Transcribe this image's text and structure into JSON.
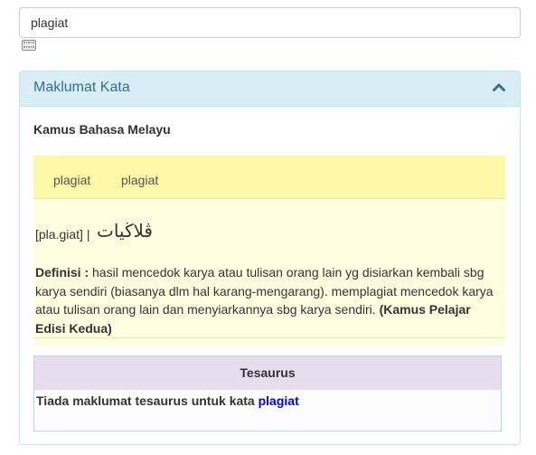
{
  "search": {
    "value": "plagiat"
  },
  "keyboard_icon": "keyboard-icon",
  "panel": {
    "title": "Maklumat Kata",
    "toggle_icon": "chevron-up-icon"
  },
  "colors": {
    "heading_bg": "#d9edf7",
    "heading_text": "#31708f",
    "entry_bg": "#fffde0",
    "entry_head_bg": "#fcf8a8",
    "thesaurus_head_bg": "#e8dcef",
    "link": "#0000ee"
  },
  "dictionary": {
    "source": "Kamus Bahasa Melayu",
    "words": [
      "plagiat",
      "plagiat"
    ],
    "pronunciation": "[pla.giat] |",
    "jawi": "ڤلاڬيات",
    "definition_label": "Definisi :",
    "definition_text": " hasil mencedok karya atau tulisan orang lain yg disiarkan kembali sbg karya sendiri (biasanya dlm hal karang-mengarang). memplagiat mencedok karya atau tulisan orang lain dan menyiarkannya sbg karya sendiri. ",
    "definition_source": "(Kamus Pelajar Edisi Kedua)"
  },
  "thesaurus": {
    "title": "Tesaurus",
    "message": "Tiada maklumat tesaurus untuk kata ",
    "word": "plagiat"
  }
}
